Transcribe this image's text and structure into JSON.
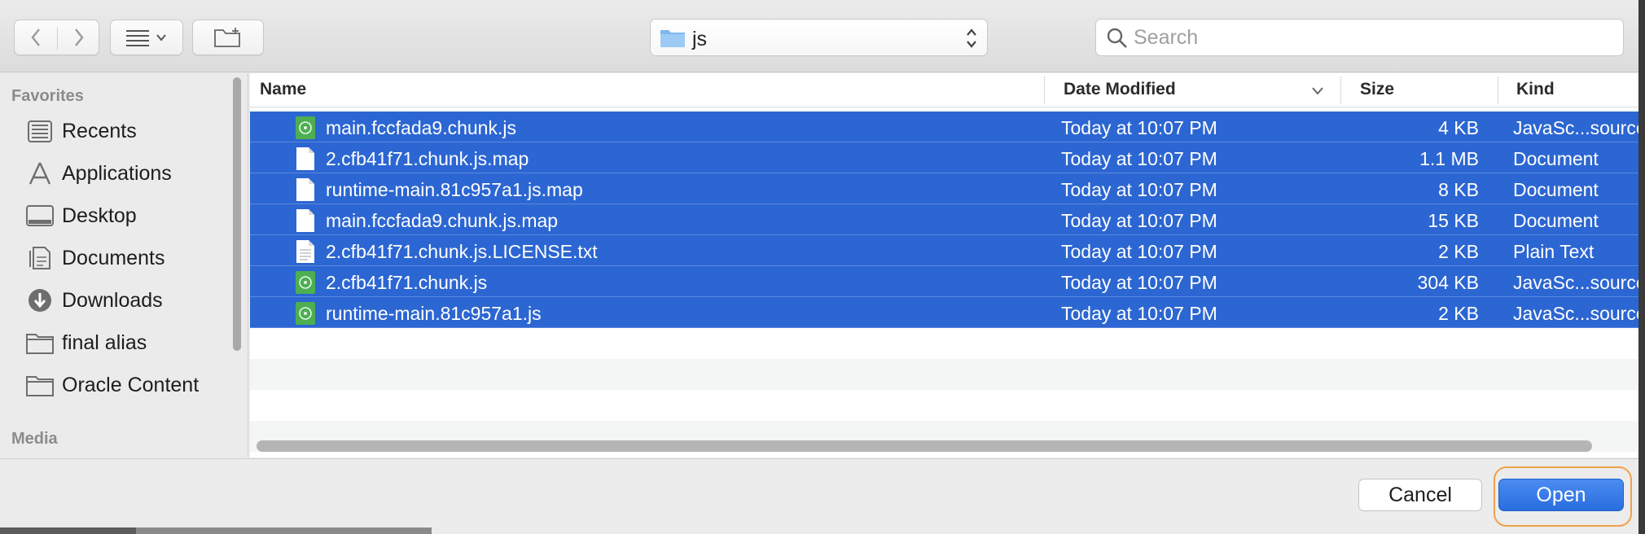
{
  "toolbar": {
    "path_folder": "js",
    "search_placeholder": "Search"
  },
  "sidebar": {
    "favorites_label": "Favorites",
    "items": [
      {
        "label": "Recents",
        "icon": "recents-icon"
      },
      {
        "label": "Applications",
        "icon": "applications-icon"
      },
      {
        "label": "Desktop",
        "icon": "desktop-icon"
      },
      {
        "label": "Documents",
        "icon": "documents-icon"
      },
      {
        "label": "Downloads",
        "icon": "downloads-icon"
      },
      {
        "label": "final alias",
        "icon": "folder-icon"
      },
      {
        "label": "Oracle Content",
        "icon": "folder-icon"
      }
    ],
    "media_label": "Media"
  },
  "columns": {
    "name": "Name",
    "date": "Date Modified",
    "size": "Size",
    "kind": "Kind"
  },
  "files": [
    {
      "name": "main.fccfada9.chunk.js",
      "date": "Today at 10:07 PM",
      "size": "4 KB",
      "kind": "JavaSc...source",
      "icon": "javascript-file-icon"
    },
    {
      "name": "2.cfb41f71.chunk.js.map",
      "date": "Today at 10:07 PM",
      "size": "1.1 MB",
      "kind": "Document",
      "icon": "document-file-icon"
    },
    {
      "name": "runtime-main.81c957a1.js.map",
      "date": "Today at 10:07 PM",
      "size": "8 KB",
      "kind": "Document",
      "icon": "document-file-icon"
    },
    {
      "name": "main.fccfada9.chunk.js.map",
      "date": "Today at 10:07 PM",
      "size": "15 KB",
      "kind": "Document",
      "icon": "document-file-icon"
    },
    {
      "name": "2.cfb41f71.chunk.js.LICENSE.txt",
      "date": "Today at 10:07 PM",
      "size": "2 KB",
      "kind": "Plain Text",
      "icon": "text-file-icon"
    },
    {
      "name": "2.cfb41f71.chunk.js",
      "date": "Today at 10:07 PM",
      "size": "304 KB",
      "kind": "JavaSc...source",
      "icon": "javascript-file-icon"
    },
    {
      "name": "runtime-main.81c957a1.js",
      "date": "Today at 10:07 PM",
      "size": "2 KB",
      "kind": "JavaSc...source",
      "icon": "javascript-file-icon"
    }
  ],
  "buttons": {
    "cancel": "Cancel",
    "open": "Open"
  },
  "colors": {
    "selection": "#2c66d2",
    "accent": "#2a6ddf",
    "focus_ring": "#f0a04a",
    "js_icon": "#4caf50"
  }
}
